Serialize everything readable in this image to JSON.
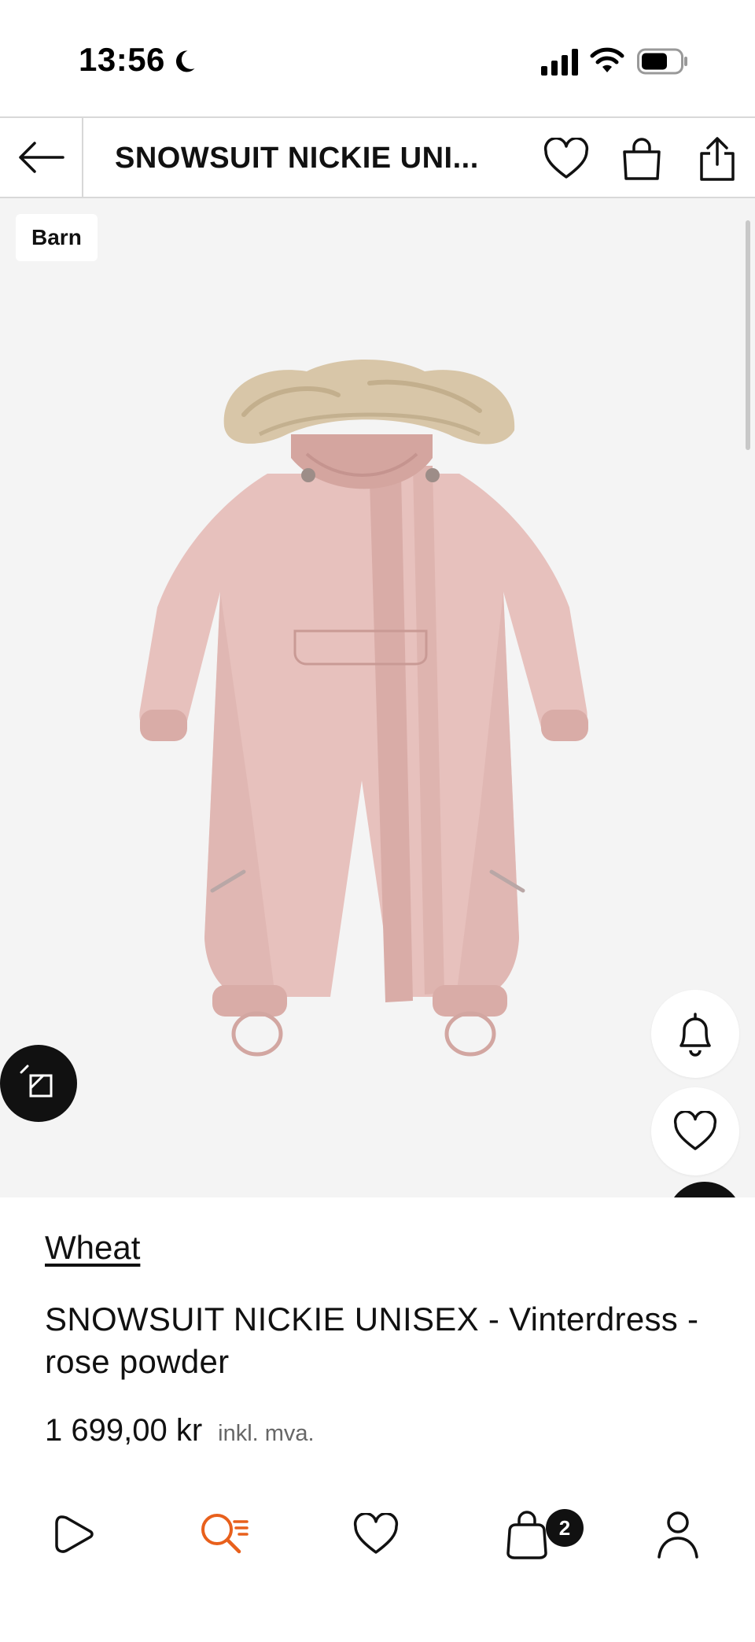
{
  "status_bar": {
    "time": "13:56",
    "icons": [
      "moon-icon",
      "signal-icon",
      "wifi-icon",
      "battery-icon"
    ]
  },
  "header": {
    "title": "SNOWSUIT NICKIE UNI...",
    "icons": [
      "back-arrow-icon",
      "heart-icon",
      "shopping-bag-icon",
      "share-icon"
    ]
  },
  "product_image": {
    "badge": "Barn",
    "background_color": "#f4f4f4",
    "product_color": "#e7c1bd",
    "buttons": [
      "visual-search-icon",
      "bell-icon",
      "heart-icon"
    ]
  },
  "product": {
    "brand": "Wheat",
    "title": "SNOWSUIT NICKIE UNISEX - Vinterdress - rose powder",
    "price": "1 699,00 kr",
    "vat_note": "inkl. mva."
  },
  "bottom_nav": {
    "items": [
      "play-icon",
      "search-icon",
      "heart-icon",
      "bag-icon",
      "profile-icon"
    ],
    "active_item": "search-icon",
    "active_color": "#e8601c",
    "cart_count": "2"
  }
}
